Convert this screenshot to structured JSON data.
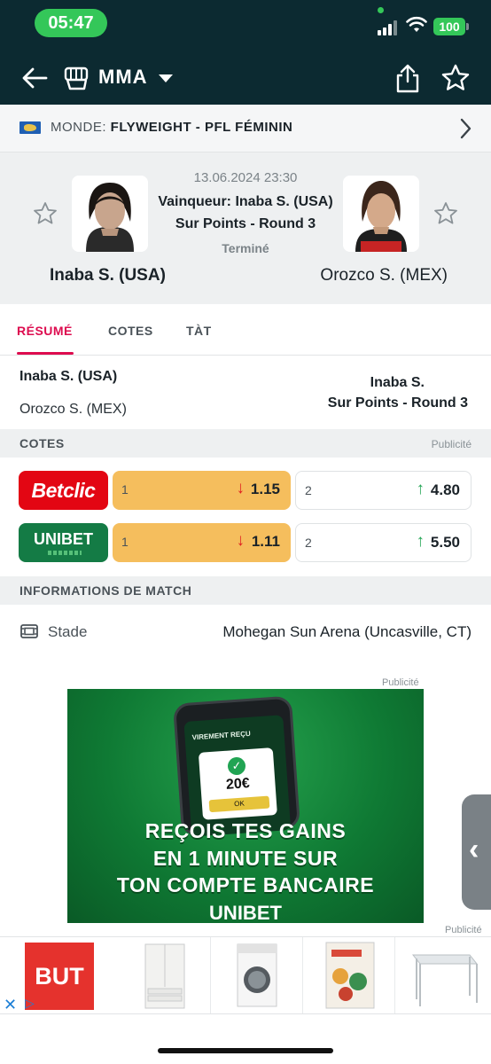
{
  "status_bar": {
    "time": "05:47",
    "battery": "100"
  },
  "header": {
    "title": "MMA"
  },
  "breadcrumb": {
    "region": "MONDE:",
    "competition": "FLYWEIGHT - PFL FÉMININ"
  },
  "match": {
    "date": "13.06.2024 23:30",
    "winner_line": "Vainqueur: Inaba S. (USA)",
    "method_line": "Sur Points - Round 3",
    "status": "Terminé",
    "fighter_left": "Inaba S. (USA)",
    "fighter_right": "Orozco S. (MEX)"
  },
  "tabs": [
    {
      "label": "RÉSUMÉ",
      "active": true
    },
    {
      "label": "COTES",
      "active": false
    },
    {
      "label": "TÀT",
      "active": false
    }
  ],
  "summary": {
    "winner": "Inaba S. (USA)",
    "loser": "Orozco S. (MEX)",
    "result_name": "Inaba S.",
    "result_method": "Sur Points - Round 3"
  },
  "odds_section": {
    "title": "COTES",
    "ad_label": "Publicité"
  },
  "odds": [
    {
      "bookmaker": "Betclic",
      "label1": "1",
      "odd1": "1.15",
      "trend1": "↓",
      "label2": "2",
      "odd2": "4.80",
      "trend2": "↑"
    },
    {
      "bookmaker": "UNIBET",
      "label1": "1",
      "odd1": "1.11",
      "trend1": "↓",
      "label2": "2",
      "odd2": "5.50",
      "trend2": "↑"
    }
  ],
  "info_section": {
    "title": "INFORMATIONS DE MATCH"
  },
  "info": {
    "key": "Stade",
    "value": "Mohegan Sun Arena (Uncasville, CT)"
  },
  "ad_banner": {
    "label": "Publicité",
    "phone_title": "VIREMENT REÇU",
    "amount": "20€",
    "ok": "OK",
    "slogan1": "REÇOIS TES GAINS",
    "slogan2": "EN 1 MINUTE SUR",
    "slogan3": "TON COMPTE BANCAIRE",
    "brand": "UNIBET"
  },
  "ad_bottom": {
    "label": "Publicité",
    "brand": "BUT"
  },
  "colors": {
    "header": "#0c2a31",
    "accent": "#dd0c4f",
    "odd_highlight": "#f5be5d",
    "betclic": "#e30613",
    "unibet": "#147b45"
  }
}
